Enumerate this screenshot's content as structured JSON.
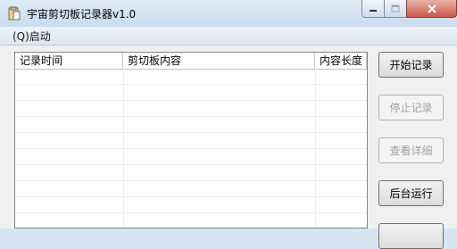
{
  "window": {
    "title": "宇宙剪切板记录器v1.0",
    "controls": {
      "minimize_icon": "minimize-icon",
      "maximize_icon": "maximize-icon",
      "close_icon": "close-icon"
    }
  },
  "menu": {
    "items": [
      {
        "label": "(Q)启动"
      }
    ]
  },
  "list": {
    "columns": [
      {
        "label": "记录时间"
      },
      {
        "label": "剪切板内容"
      },
      {
        "label": "内容长度"
      }
    ],
    "rows": []
  },
  "buttons": {
    "start": "开始记录",
    "stop": "停止记录",
    "view": "查看详细",
    "background": "后台运行"
  },
  "colors": {
    "accent": "#d7e4f2",
    "close": "#c9594a"
  }
}
